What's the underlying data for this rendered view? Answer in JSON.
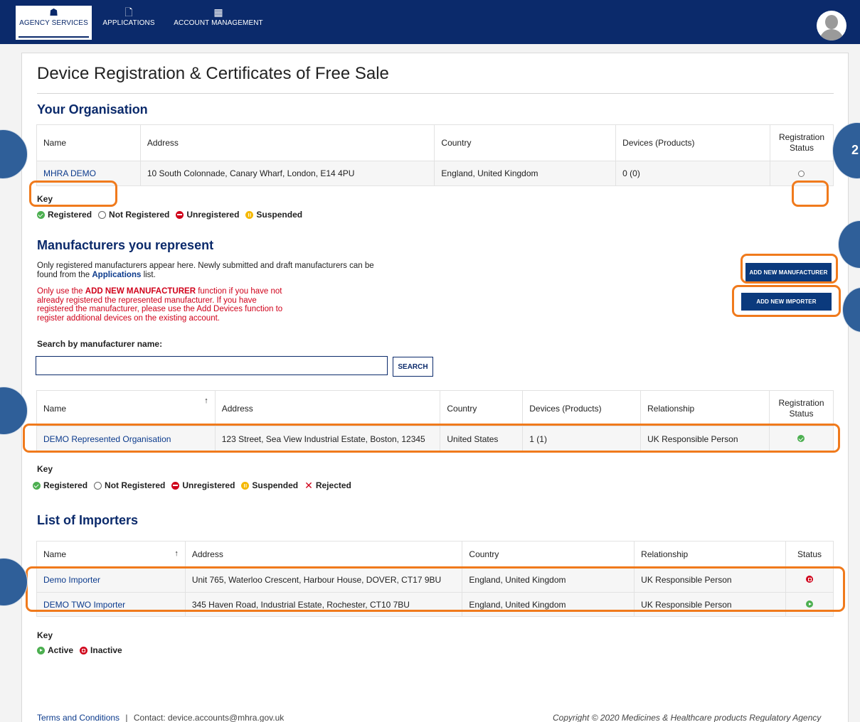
{
  "nav": {
    "items": [
      {
        "label": "AGENCY SERVICES",
        "icon": "home-icon",
        "glyph": "☗"
      },
      {
        "label": "APPLICATIONS",
        "icon": "document-icon",
        "glyph": "🗋"
      },
      {
        "label": "ACCOUNT MANAGEMENT",
        "icon": "building-icon",
        "glyph": "▦"
      }
    ]
  },
  "page_title": "Device Registration & Certificates of Free Sale",
  "your_org": {
    "title": "Your Organisation",
    "columns": [
      "Name",
      "Address",
      "Country",
      "Devices (Products)",
      "Registration Status"
    ],
    "rows": [
      {
        "name": "MHRA DEMO",
        "address": "10 South Colonnade, Canary Wharf, London, E14 4PU",
        "country": "England, United Kingdom",
        "devices": "0 (0)",
        "status": "not-registered"
      }
    ],
    "key_title": "Key",
    "key": [
      "Registered",
      "Not Registered",
      "Unregistered",
      "Suspended"
    ]
  },
  "manufacturers": {
    "title": "Manufacturers you represent",
    "desc_1": "Only registered manufacturers appear here. Newly submitted and draft manufacturers can be",
    "desc_2": "found from the ",
    "desc_link": "Applications",
    "desc_3": " list.",
    "warn_1": "Only use the ",
    "warn_bold": "ADD NEW MANUFACTURER",
    "warn_2": " function if you have not",
    "warn_3": "already registered the represented manufacturer. If you have",
    "warn_4": "registered the manufacturer, please use the Add Devices function to",
    "warn_5": "register additional devices on the existing account.",
    "add_manufacturer_label": "ADD NEW MANUFACTURER",
    "add_importer_label": "ADD NEW IMPORTER",
    "search_label": "Search by manufacturer name:",
    "search_value": "",
    "search_button": "SEARCH",
    "columns": [
      "Name",
      "Address",
      "Country",
      "Devices (Products)",
      "Relationship",
      "Registration Status"
    ],
    "sort_glyph": "↑",
    "rows": [
      {
        "name": "DEMO Represented Organisation",
        "address": "123 Street, Sea View Industrial Estate, Boston, 12345",
        "country": "United States",
        "devices": "1 (1)",
        "relationship": "UK Responsible Person",
        "status": "registered"
      }
    ],
    "key_title": "Key",
    "key": [
      "Registered",
      "Not Registered",
      "Unregistered",
      "Suspended",
      "Rejected"
    ]
  },
  "importers": {
    "title": "List of Importers",
    "columns": [
      "Name",
      "Address",
      "Country",
      "Relationship",
      "Status"
    ],
    "sort_glyph": "↑",
    "rows": [
      {
        "name": "Demo Importer",
        "address": "Unit 765, Waterloo Crescent, Harbour House, DOVER, CT17 9BU",
        "country": "England, United Kingdom",
        "relationship": "UK Responsible Person",
        "status": "inactive"
      },
      {
        "name": "DEMO TWO Importer",
        "address": "345 Haven Road, Industrial Estate, Rochester, CT10 7BU",
        "country": "England, United Kingdom",
        "relationship": "UK Responsible Person",
        "status": "active"
      }
    ],
    "key_title": "Key",
    "key": [
      "Active",
      "Inactive"
    ]
  },
  "callout_number": "2",
  "footer": {
    "terms": "Terms and Conditions",
    "separator": "|",
    "contact": "Contact: device.accounts@mhra.gov.uk",
    "copyright": "Copyright © 2020 Medicines & Healthcare products Regulatory Agency"
  },
  "colors": {
    "nav_bg": "#0b2a6b",
    "heading": "#0b2a6b",
    "link": "#0b3a8c",
    "warning": "#d0021b",
    "callout_orange": "#f07a1c",
    "bubble_blue": "#2f5f99"
  }
}
